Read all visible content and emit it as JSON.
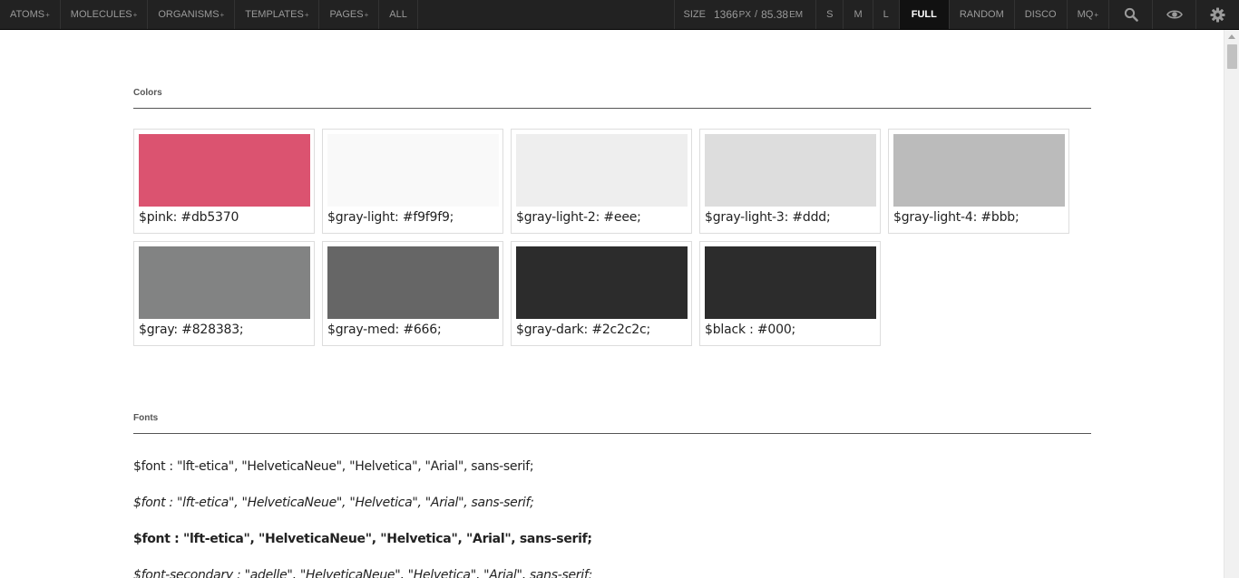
{
  "toolbar": {
    "nav": [
      {
        "label": "ATOMS",
        "has_plus": true
      },
      {
        "label": "MOLECULES",
        "has_plus": true
      },
      {
        "label": "ORGANISMS",
        "has_plus": true
      },
      {
        "label": "TEMPLATES",
        "has_plus": true
      },
      {
        "label": "PAGES",
        "has_plus": true
      },
      {
        "label": "ALL",
        "has_plus": false
      }
    ],
    "plus_symbol": "+",
    "size": {
      "label": "SIZE",
      "px_value": "1366",
      "px_unit": "PX",
      "separator": "/",
      "em_value": "85.38",
      "em_unit": "EM"
    },
    "buttons": {
      "s": "S",
      "m": "M",
      "l": "L",
      "full": "FULL",
      "random": "RANDOM",
      "disco": "DISCO",
      "mq": "MQ"
    },
    "active_button": "full",
    "icons": [
      "search-icon",
      "eye-icon",
      "gear-icon"
    ]
  },
  "colors": {
    "title": "Colors",
    "swatches": [
      {
        "caption": "$pink: #db5370",
        "color": "#db5370"
      },
      {
        "caption": "$gray-light: #f9f9f9;",
        "color": "#f9f9f9"
      },
      {
        "caption": "$gray-light-2: #eee;",
        "color": "#eeeeee"
      },
      {
        "caption": "$gray-light-3: #ddd;",
        "color": "#dddddd"
      },
      {
        "caption": "$gray-light-4: #bbb;",
        "color": "#bbbbbb"
      },
      {
        "caption": "$gray: #828383;",
        "color": "#828383"
      },
      {
        "caption": "$gray-med: #666;",
        "color": "#666666"
      },
      {
        "caption": "$gray-dark: #2c2c2c;",
        "color": "#2c2c2c"
      },
      {
        "caption": "$black : #000;",
        "color": "#2c2c2c"
      }
    ]
  },
  "fonts": {
    "title": "Fonts",
    "lines": [
      {
        "text": "$font : \"lft-etica\", \"HelveticaNeue\", \"Helvetica\", \"Arial\", sans-serif;",
        "style": "regular"
      },
      {
        "text": "$font : \"lft-etica\", \"HelveticaNeue\", \"Helvetica\", \"Arial\", sans-serif;",
        "style": "italic"
      },
      {
        "text": "$font : \"lft-etica\", \"HelveticaNeue\", \"Helvetica\", \"Arial\", sans-serif;",
        "style": "bold"
      },
      {
        "text": "$font-secondary : \"adelle\", \"HelveticaNeue\", \"Helvetica\", \"Arial\", sans-serif;",
        "style": "italic"
      }
    ]
  }
}
